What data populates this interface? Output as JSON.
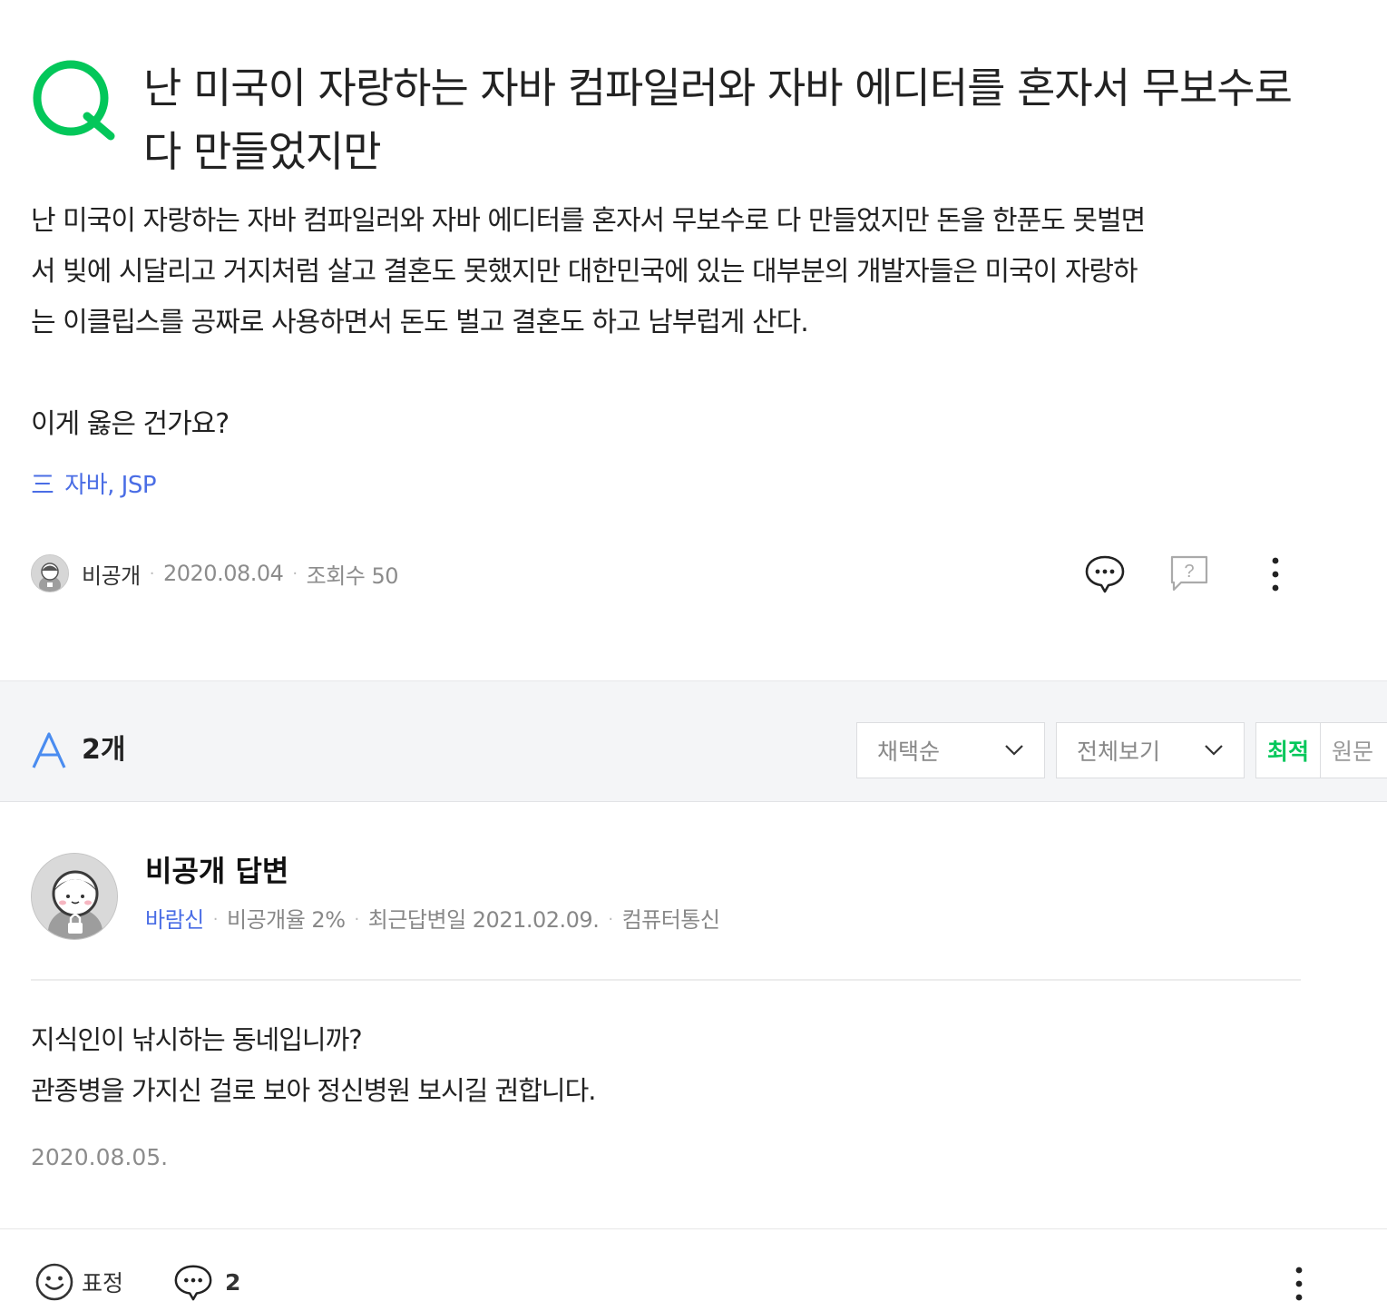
{
  "question": {
    "marker": "Q",
    "title": "난 미국이 자랑하는 자바 컴파일러와 자바 에디터를 혼자서 무보수로 다 만들었지만",
    "body_lines": [
      "난 미국이 자랑하는 자바 컴파일러와 자바 에디터를 혼자서 무보수로 다 만들었지만 돈을 한푼도 못벌면",
      "서 빚에 시달리고 거지처럼 살고 결혼도 못했지만 대한민국에 있는 대부분의 개발자들은 미국이 자랑하",
      "는 이클립스를 공짜로 사용하면서 돈도 벌고 결혼도 하고 남부럽게 산다.",
      "",
      "이게 옳은 건가요?"
    ],
    "tags": "자바, JSP",
    "tag_icon": "三",
    "author": "비공개",
    "date": "2020.08.04",
    "views": "조회수 50",
    "brand_color": "#03c75a",
    "icons": [
      "comment-icon",
      "question-icon",
      "more-icon"
    ]
  },
  "answers_bar": {
    "marker": "A",
    "count": "2개",
    "sort_select": "채택순",
    "filter_select": "전체보기",
    "toggle_active": "최적",
    "toggle_inactive": "원문"
  },
  "answer": {
    "name": "비공개 답변",
    "grade": "바람신",
    "private_rate": "비공개율 2%",
    "recent": "최근답변일 2021.02.09.",
    "category": "컴퓨터통신",
    "body_lines": [
      "지식인이 낚시하는 동네입니까?",
      "관종병을 가지신 걸로 보아 정신병원 보시길 권합니다."
    ],
    "date": "2020.08.05.",
    "reaction_label": "표정",
    "comment_count": "2"
  }
}
